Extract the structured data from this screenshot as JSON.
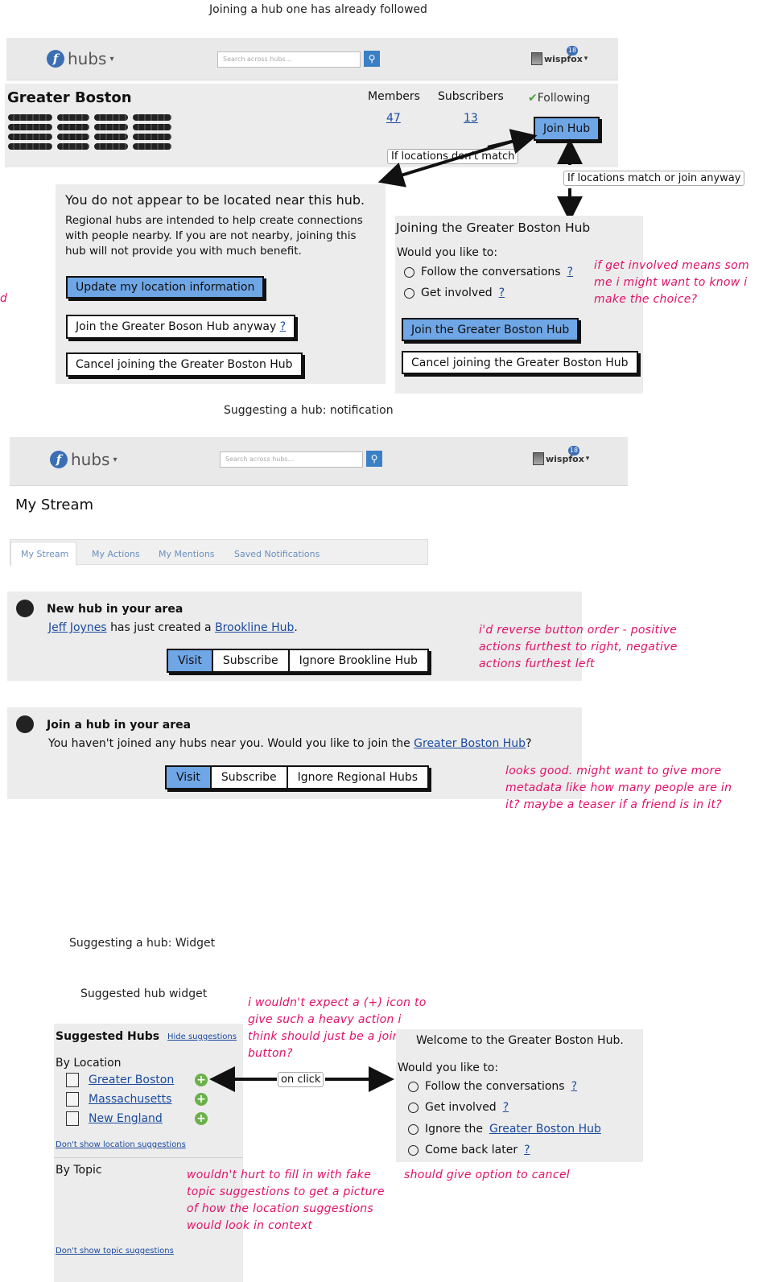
{
  "captions": {
    "c1": "Joining a hub one has already followed",
    "c2": "Suggesting a hub: notification",
    "c3": "Suggesting a hub: Widget",
    "c4": "Suggested hub widget"
  },
  "nav": {
    "logo": "hubs",
    "search_placeholder": "Search across hubs...",
    "user": "wispfox",
    "badge": "18"
  },
  "hub": {
    "title": "Greater Boston",
    "members_label": "Members",
    "members": "47",
    "subscribers_label": "Subscribers",
    "subscribers": "13",
    "following": "Following",
    "join": "Join Hub"
  },
  "flow": {
    "no_match": "If locations don't match",
    "match": "If locations match or join anyway"
  },
  "dialog_far": {
    "title": "You do not appear to be located near this hub.",
    "body": "Regional hubs are intended to help create connections with people nearby. If you are not nearby, joining this hub will not provide you with much benefit.",
    "update": "Update my location information",
    "join_anyway": "Join the Greater Boson Hub anyway",
    "cancel": "Cancel joining the Greater Boston Hub"
  },
  "dialog_join": {
    "title": "Joining the Greater Boston Hub",
    "question": "Would you like to:",
    "opt1": "Follow the conversations",
    "opt2": "Get involved",
    "join": "Join the Greater Boston Hub",
    "cancel": "Cancel joining the Greater Boston Hub"
  },
  "stream": {
    "title": "My Stream",
    "tabs": [
      "My Stream",
      "My Actions",
      "My Mentions",
      "Saved Notifications"
    ]
  },
  "notif1": {
    "title": "New hub in your area",
    "user": "Jeff Joynes",
    "mid": "has just created a",
    "hub": "Brookline Hub",
    "end": ".",
    "visit": "Visit",
    "subscribe": "Subscribe",
    "ignore": "Ignore Brookline Hub"
  },
  "notif2": {
    "title": "Join a hub in your area",
    "text": "You haven't joined any hubs near you. Would you like to join the",
    "hub": "Greater Boston Hub",
    "end": "?",
    "visit": "Visit",
    "subscribe": "Subscribe",
    "ignore": "Ignore Regional Hubs"
  },
  "widget": {
    "title": "Suggested Hubs",
    "hide": "Hide suggestions",
    "by_location": "By Location",
    "items": [
      "Greater Boston",
      "Massachusetts",
      "New England"
    ],
    "dont_loc": "Don't show location suggestions",
    "by_topic": "By Topic",
    "dont_topic": "Don't show topic suggestions",
    "on_click": "on click"
  },
  "welcome": {
    "title": "Welcome to the Greater Boston Hub.",
    "question": "Would you like to:",
    "opt1": "Follow the conversations",
    "opt2": "Get involved",
    "opt3_pre": "Ignore the",
    "opt3_link": "Greater Boston Hub",
    "opt4": "Come back later"
  },
  "notes": {
    "n0": "d",
    "n1": "if get involved means som me i might want to know i make the choice?",
    "n2": "i'd reverse button order - positive actions furthest to right, negative actions furthest left",
    "n3": "looks good. might want to give more metadata like how many people are in it? maybe a teaser if a friend is in it?",
    "n4": "i wouldn't expect a (+) icon to give such a heavy action i think should just be a join button?",
    "n5": "wouldn't hurt to fill in with fake topic suggestions to get a picture of how the location suggestions would look in context",
    "n6": "should give option to cancel"
  },
  "colors": {
    "accent": "#6fa6e6",
    "note": "#e0116a",
    "link": "#1a4a9e"
  }
}
